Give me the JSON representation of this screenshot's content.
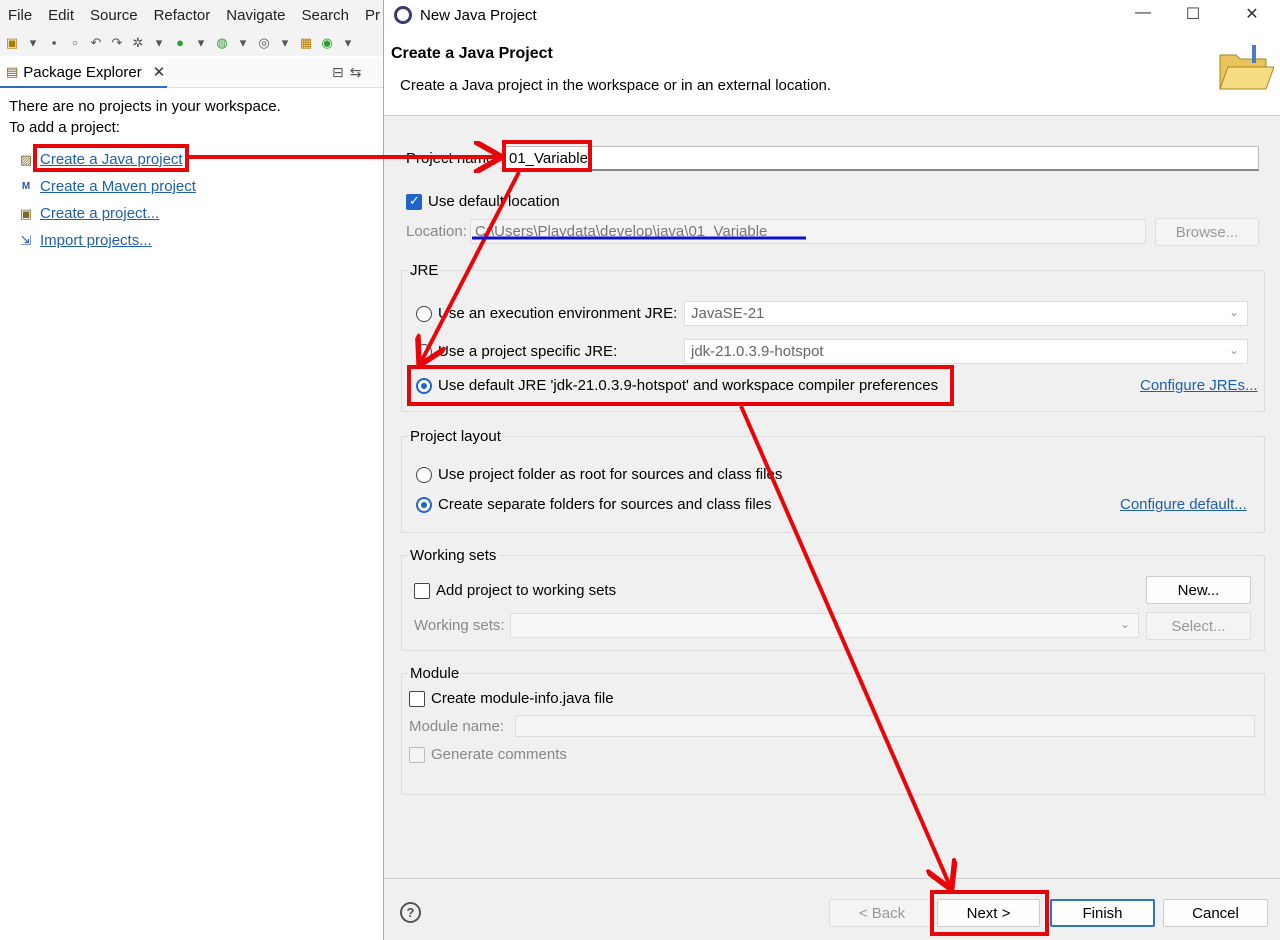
{
  "ide": {
    "menu": [
      "File",
      "Edit",
      "Source",
      "Refactor",
      "Navigate",
      "Search",
      "Pr"
    ],
    "package_explorer_tab": "Package Explorer",
    "empty_line1": "There are no projects in your workspace.",
    "empty_line2": "To add a project:",
    "links": [
      "Create a Java project",
      "Create a Maven project",
      "Create a project...",
      "Import projects..."
    ]
  },
  "dialog": {
    "window_title": "New Java Project",
    "heading": "Create a Java Project",
    "description": "Create a Java project in the workspace or in an external location.",
    "project_name_label": "Project name:",
    "project_name_value": "01_Variable",
    "use_default_location_label": "Use default location",
    "use_default_location_checked": true,
    "location_label": "Location:",
    "location_value": "C:\\Users\\Playdata\\develop\\java\\01_Variable",
    "browse_label": "Browse...",
    "jre": {
      "group_title": "JRE",
      "opt_exec_env": "Use an execution environment JRE:",
      "exec_env_value": "JavaSE-21",
      "opt_specific": "Use a project specific JRE:",
      "specific_value": "jdk-21.0.3.9-hotspot",
      "opt_default": "Use default JRE 'jdk-21.0.3.9-hotspot' and workspace compiler preferences",
      "configure_jres": "Configure JREs..."
    },
    "layout": {
      "group_title": "Project layout",
      "opt_root": "Use project folder as root for sources and class files",
      "opt_separate": "Create separate folders for sources and class files",
      "configure_default": "Configure default..."
    },
    "working_sets": {
      "group_title": "Working sets",
      "add_label": "Add project to working sets",
      "new_label": "New...",
      "ws_label": "Working sets:",
      "select_label": "Select..."
    },
    "module": {
      "group_title": "Module",
      "create_label": "Create module-info.java file",
      "name_label": "Module name:",
      "gen_comments": "Generate comments"
    },
    "buttons": {
      "back": "< Back",
      "next": "Next >",
      "finish": "Finish",
      "cancel": "Cancel"
    }
  },
  "annotation_color": "#e8050a",
  "underline_color": "#1010d0"
}
